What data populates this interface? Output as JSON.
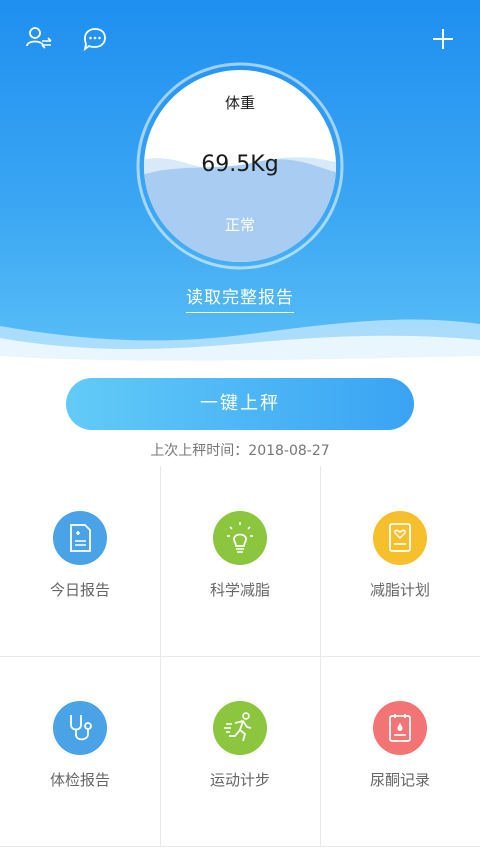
{
  "header": {
    "icons": [
      "switch-user-icon",
      "message-icon",
      "add-icon"
    ]
  },
  "gauge": {
    "title": "体重",
    "value": "69.5Kg",
    "status": "正常",
    "fill_level": 0.55
  },
  "report_link": "读取完整报告",
  "weigh_button": "一键上秤",
  "last_weigh": "上次上秤时间：2018-08-27",
  "colors": {
    "hero_top": "#1f8ff0",
    "hero_bottom": "#5cc0f7",
    "blue": "#4aa3e6",
    "green": "#8cc63e",
    "yellow": "#f6bf2c",
    "red": "#f27474"
  },
  "grid": [
    {
      "label": "今日报告",
      "icon": "report-icon",
      "color": "#4aa3e6"
    },
    {
      "label": "科学减脂",
      "icon": "lightbulb-icon",
      "color": "#8cc63e"
    },
    {
      "label": "减脂计划",
      "icon": "plan-icon",
      "color": "#f6bf2c"
    },
    {
      "label": "体检报告",
      "icon": "stethoscope-icon",
      "color": "#4aa3e6"
    },
    {
      "label": "运动计步",
      "icon": "running-icon",
      "color": "#8cc63e"
    },
    {
      "label": "尿酮记录",
      "icon": "urine-record-icon",
      "color": "#f27474"
    }
  ]
}
